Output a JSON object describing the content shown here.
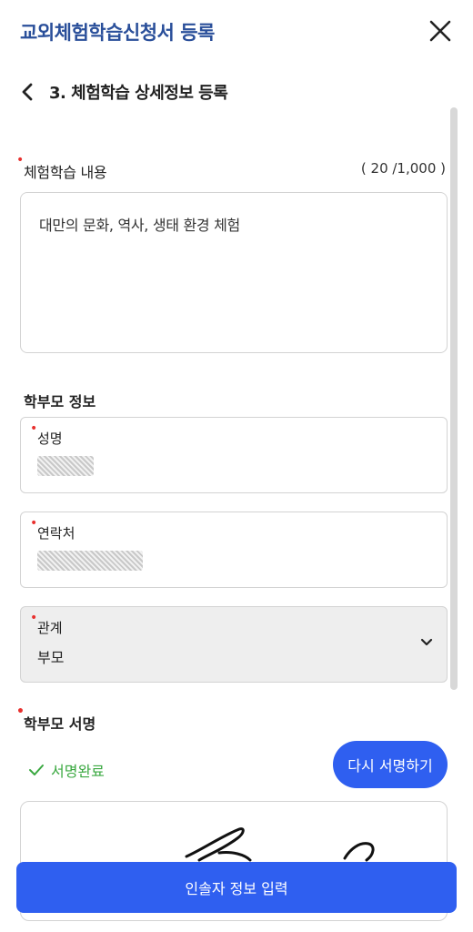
{
  "header": {
    "title": "교외체험학습신청서 등록"
  },
  "step": {
    "title": "3. 체험학습 상세정보 등록"
  },
  "content": {
    "label": "체험학습 내용",
    "counter": "( 20 /1,000 )",
    "text": "대만의 문화, 역사, 생태 환경 체험"
  },
  "parent": {
    "section_label": "학부모 정보",
    "name_label": "성명",
    "contact_label": "연락처",
    "relation_label": "관계",
    "relation_value": "부모"
  },
  "signature": {
    "label": "학부모 서명",
    "status": "서명완료",
    "resign_label": "다시 서명하기"
  },
  "footer": {
    "submit_label": "인솔자 정보 입력"
  },
  "colors": {
    "accent": "#2f5ff0",
    "title": "#2a4f9a",
    "success": "#3aa840",
    "required": "#e8302e"
  }
}
